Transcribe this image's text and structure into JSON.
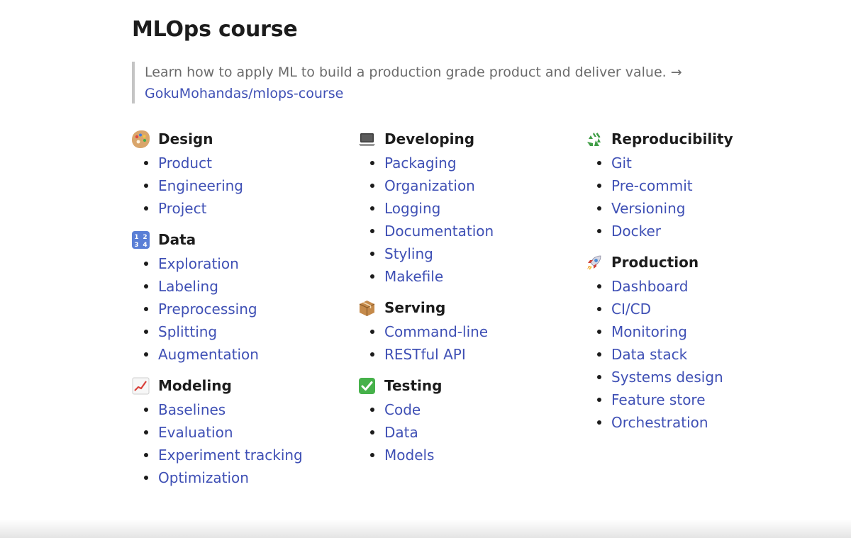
{
  "title": "MLOps course",
  "intro": {
    "text": "Learn how to apply ML to build a production grade product and deliver value. →",
    "link": "GokuMohandas/mlops-course"
  },
  "columns": [
    {
      "sections": [
        {
          "icon": "artist-palette-icon",
          "title": "Design",
          "items": [
            "Product",
            "Engineering",
            "Project"
          ]
        },
        {
          "icon": "input-numbers-icon",
          "title": "Data",
          "items": [
            "Exploration",
            "Labeling",
            "Preprocessing",
            "Splitting",
            "Augmentation"
          ]
        },
        {
          "icon": "chart-increasing-icon",
          "title": "Modeling",
          "items": [
            "Baselines",
            "Evaluation",
            "Experiment tracking",
            "Optimization"
          ]
        }
      ]
    },
    {
      "sections": [
        {
          "icon": "laptop-icon",
          "title": "Developing",
          "items": [
            "Packaging",
            "Organization",
            "Logging",
            "Documentation",
            "Styling",
            "Makefile"
          ]
        },
        {
          "icon": "package-icon",
          "title": "Serving",
          "items": [
            "Command-line",
            "RESTful API"
          ]
        },
        {
          "icon": "check-mark-button-icon",
          "title": "Testing",
          "items": [
            "Code",
            "Data",
            "Models"
          ]
        }
      ]
    },
    {
      "sections": [
        {
          "icon": "recycling-symbol-icon",
          "title": "Reproducibility",
          "items": [
            "Git",
            "Pre-commit",
            "Versioning",
            "Docker"
          ]
        },
        {
          "icon": "rocket-icon",
          "title": "Production",
          "items": [
            "Dashboard",
            "CI/CD",
            "Monitoring",
            "Data stack",
            "Systems design",
            "Feature store",
            "Orchestration"
          ]
        }
      ]
    }
  ],
  "colors": {
    "link": "#3f50b5",
    "heading": "#1c1c1c",
    "muted": "#6b6b6b",
    "quote_border": "#c4c4c4"
  }
}
